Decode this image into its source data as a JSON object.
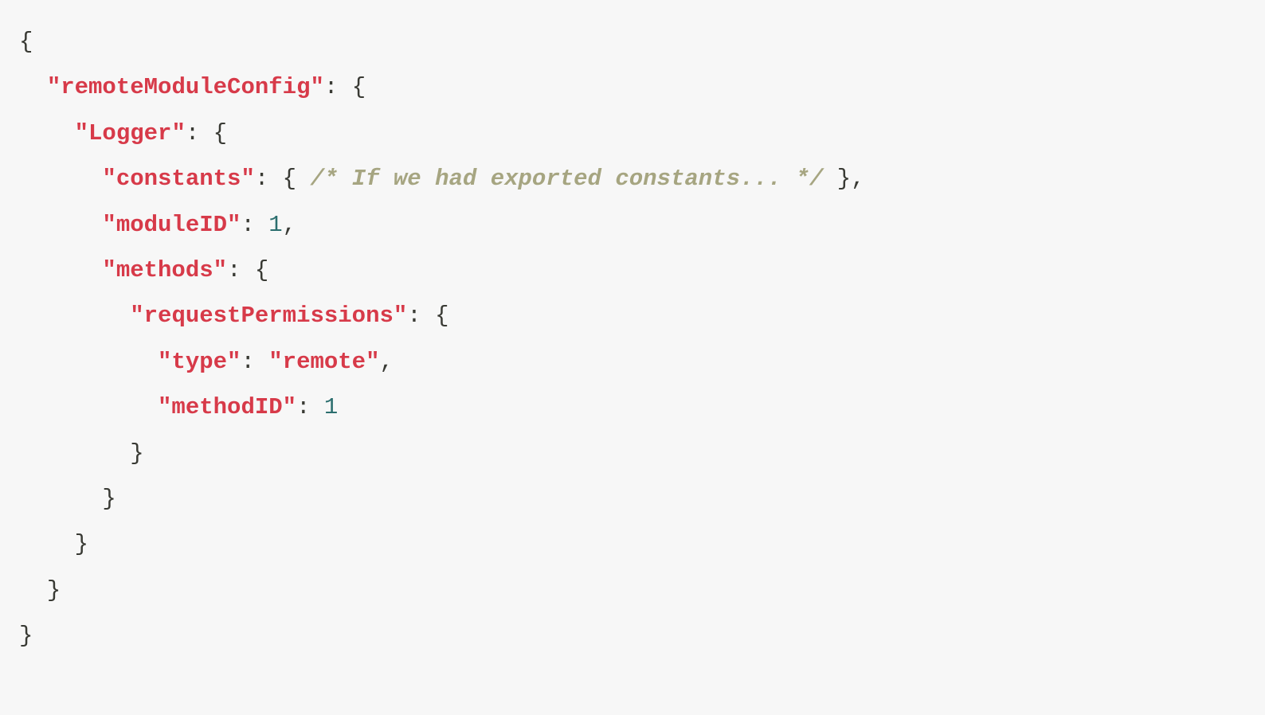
{
  "code": {
    "key_remoteModuleConfig": "\"remoteModuleConfig\"",
    "key_Logger": "\"Logger\"",
    "key_constants": "\"constants\"",
    "comment_constants": "/* If we had exported constants... */",
    "key_moduleID": "\"moduleID\"",
    "val_moduleID": "1",
    "key_methods": "\"methods\"",
    "key_requestPermissions": "\"requestPermissions\"",
    "key_type": "\"type\"",
    "val_type": "\"remote\"",
    "key_methodID": "\"methodID\"",
    "val_methodID": "1",
    "brace_open": "{",
    "brace_close": "}",
    "colon": ":",
    "comma": ",",
    "space": " "
  }
}
